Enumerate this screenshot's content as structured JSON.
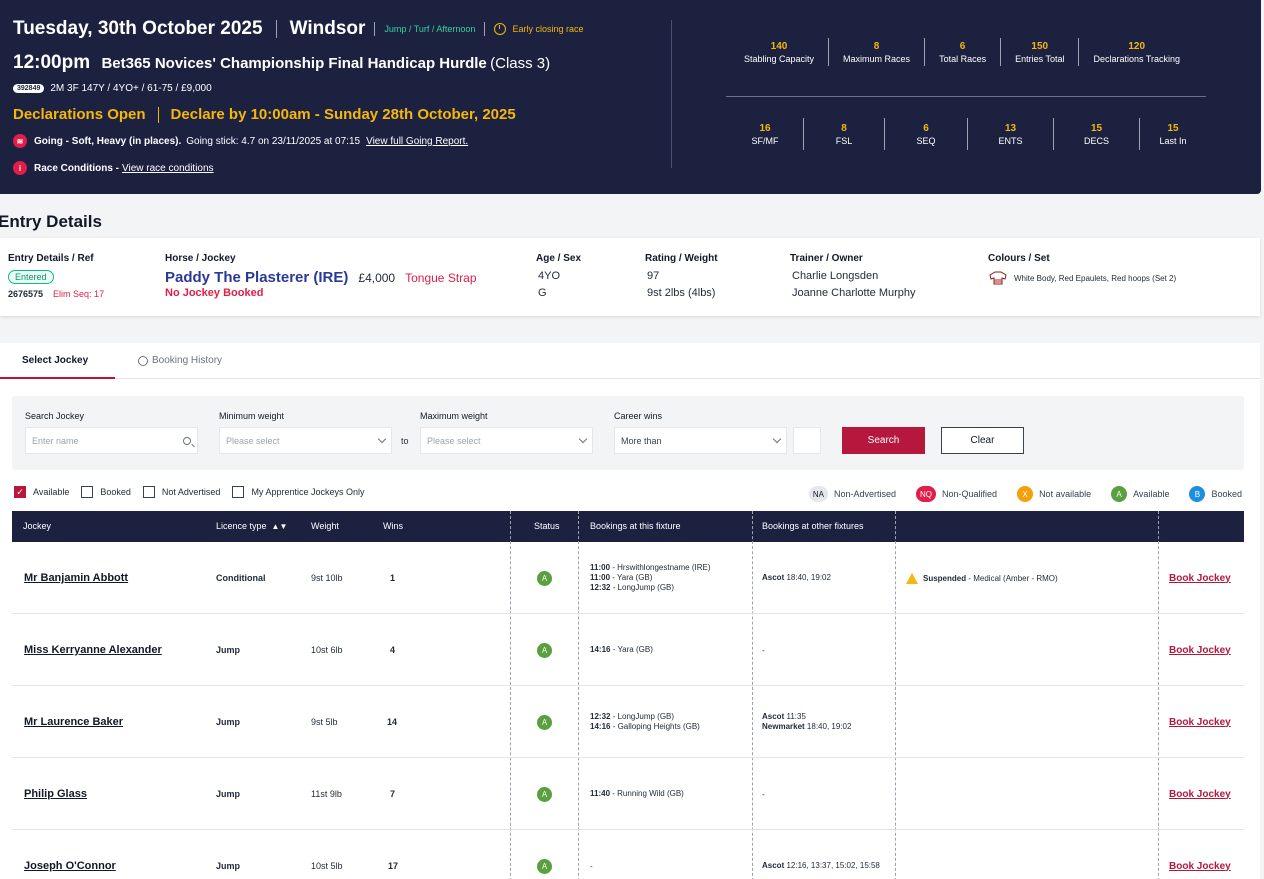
{
  "header": {
    "date": "Tuesday, 30th October 2025",
    "course": "Windsor",
    "meta": "Jump / Turf / Afternoon",
    "early": "Early closing race",
    "time": "12:00pm",
    "race_name": "Bet365 Novices' Championship Final Handicap Hurdle",
    "race_class": "(Class 3)",
    "race_id": "392849",
    "race_info": "2M 3F 147Y  / 4YO+  / 61-75 / £9,000",
    "decl_open": "Declarations Open",
    "decl_by": "Declare by 10:00am - Sunday 28th October, 2025",
    "going_label": "Going - Soft, Heavy (in places).",
    "going_stick": "Going stick: 4.7 on 23/11/2025 at 07:15",
    "going_link": "View full Going Report.",
    "conditions_label": "Race Conditions -",
    "conditions_link": "View race conditions",
    "stats_top": [
      {
        "num": "140",
        "label": "Stabling Capacity"
      },
      {
        "num": "8",
        "label": "Maximum Races"
      },
      {
        "num": "6",
        "label": "Total Races"
      },
      {
        "num": "150",
        "label": "Entries Total"
      },
      {
        "num": "120",
        "label": "Declarations Tracking"
      }
    ],
    "stats_bottom": [
      {
        "num": "16",
        "label": "SF/MF"
      },
      {
        "num": "8",
        "label": "FSL"
      },
      {
        "num": "6",
        "label": "SEQ"
      },
      {
        "num": "13",
        "label": "ENTS"
      },
      {
        "num": "15",
        "label": "DECS"
      },
      {
        "num": "15",
        "label": "Last In"
      }
    ]
  },
  "entry": {
    "title": "Entry Details",
    "ref_head": "Entry Details / Ref",
    "status": "Entered",
    "ref": "2676575",
    "elim": "Elim Seq: 17",
    "horse_head": "Horse / Jockey",
    "horse": "Paddy The Plasterer (IRE)",
    "price": "£4,000",
    "equipment": "Tongue Strap",
    "jockey_status": "No Jockey Booked",
    "age_head": "Age / Sex",
    "age": "4YO",
    "sex": "G",
    "rating_head": "Rating / Weight",
    "rating": "97",
    "weight": "9st 2lbs (4lbs)",
    "trainer_head": "Trainer / Owner",
    "trainer": "Charlie Longsden",
    "owner": "Joanne Charlotte Murphy",
    "colours_head": "Colours / Set",
    "colours": "White Body, Red Epaulets, Red hoops (Set 2)"
  },
  "tabs": {
    "select": "Select Jockey",
    "history": "Booking History"
  },
  "filters": {
    "search_label": "Search Jockey",
    "search_placeholder": "Enter name",
    "min_label": "Minimum weight",
    "min_placeholder": "Please select",
    "to": "to",
    "max_label": "Maximum weight",
    "max_placeholder": "Please select",
    "wins_label": "Career wins",
    "wins_value": "More than",
    "search_btn": "Search",
    "clear_btn": "Clear"
  },
  "checks": [
    {
      "label": "Available",
      "checked": true
    },
    {
      "label": "Booked",
      "checked": false
    },
    {
      "label": "Not Advertised",
      "checked": false
    },
    {
      "label": "My Apprentice Jockeys Only",
      "checked": false
    }
  ],
  "legend": [
    {
      "code": "NA",
      "label": "Non-Advertised",
      "bg": "#e5e7eb",
      "fg": "#111827"
    },
    {
      "code": "NQ",
      "label": "Non-Qualified",
      "bg": "#e11d48",
      "fg": "#ffffff"
    },
    {
      "code": "X",
      "label": "Not available",
      "bg": "#f5a00a",
      "fg": "#ffffff"
    },
    {
      "code": "A",
      "label": "Available",
      "bg": "#5aa041",
      "fg": "#ffffff"
    },
    {
      "code": "B",
      "label": "Booked",
      "bg": "#1d8fe0",
      "fg": "#ffffff"
    }
  ],
  "table": {
    "headers": {
      "jockey": "Jockey",
      "licence": "Licence type",
      "weight": "Weight",
      "wins": "Wins",
      "status": "Status",
      "this_fixture": "Bookings at this fixture",
      "other_fixtures": "Bookings at other fixtures"
    },
    "book_label": "Book Jockey",
    "rows": [
      {
        "name": "Mr Banjamin Abbott",
        "licence": "Conditional",
        "weight": "9st 10lb",
        "wins": "1",
        "status": "A",
        "this": [
          {
            "t": "11:00",
            "h": "Hrswithlongestname (IRE)"
          },
          {
            "t": "11:00",
            "h": "Yara (GB)"
          },
          {
            "t": "12:32",
            "h": "LongJump (GB)"
          }
        ],
        "other": [
          {
            "c": "Ascot",
            "t": "18:40, 19:02"
          }
        ],
        "note": {
          "label": "Suspended",
          "text": "Medical (Amber - RMO)"
        }
      },
      {
        "name": "Miss Kerryanne Alexander",
        "licence": "Jump",
        "weight": "10st 6lb",
        "wins": "4",
        "status": "A",
        "this": [
          {
            "t": "14:16",
            "h": "Yara (GB)"
          }
        ],
        "other_text": "-"
      },
      {
        "name": "Mr Laurence Baker",
        "licence": "Jump",
        "weight": "9st 5lb",
        "wins": "14",
        "status": "A",
        "this": [
          {
            "t": "12:32",
            "h": "LongJump (GB)"
          },
          {
            "t": "14:16",
            "h": "Galloping Heights (GB)"
          }
        ],
        "other": [
          {
            "c": "Ascot",
            "t": "11:35"
          },
          {
            "c": "Newmarket",
            "t": "18:40, 19:02"
          }
        ]
      },
      {
        "name": "Philip Glass",
        "licence": "Jump",
        "weight": "11st 9lb",
        "wins": "7",
        "status": "A",
        "this": [
          {
            "t": "11:40",
            "h": "Running Wild (GB)"
          }
        ],
        "other_text": "-"
      },
      {
        "name": "Joseph O'Connor",
        "licence": "Jump",
        "weight": "10st 5lb",
        "wins": "17",
        "status": "A",
        "this_text": "-",
        "other": [
          {
            "c": "Ascot",
            "t": "12:16, 13:37, 15:02, 15:58"
          }
        ]
      }
    ]
  }
}
